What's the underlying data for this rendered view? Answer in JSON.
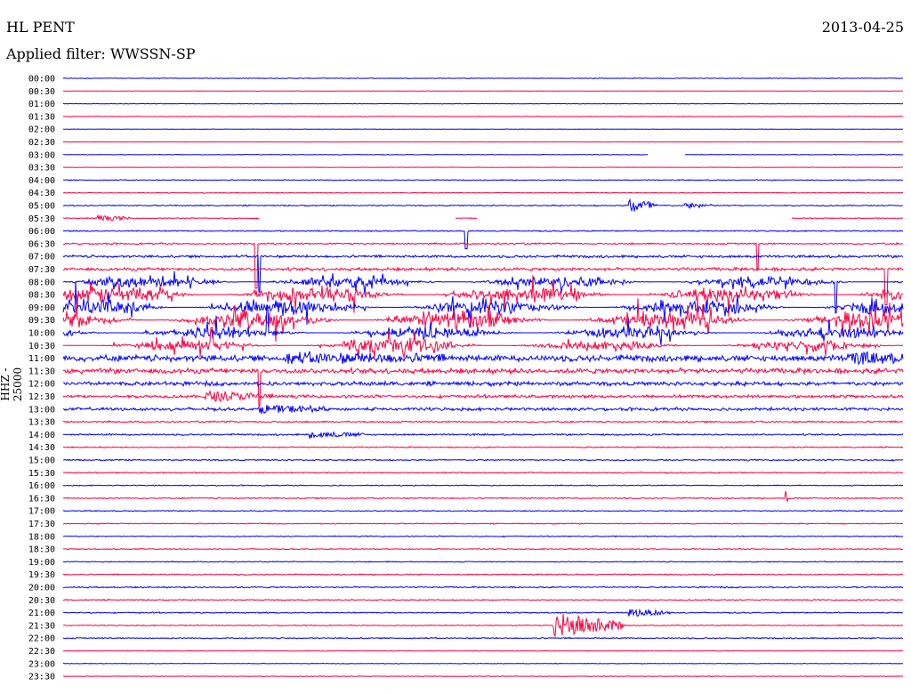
{
  "header": {
    "station": "HL PENT",
    "date": "2013-04-25",
    "filter": "Applied filter: WWSSN-SP"
  },
  "chart_data": {
    "type": "line",
    "title": "HL PENT 2013-04-25",
    "subtitle": "Applied filter: WWSSN-SP",
    "ylabel": "HHZ - 25000",
    "xlabel": "",
    "minutes_per_line": 30,
    "colors": [
      "#0000ff",
      "#ff0040"
    ],
    "row_labels": [
      "00:00",
      "00:30",
      "01:00",
      "01:30",
      "02:00",
      "02:30",
      "03:00",
      "03:30",
      "04:00",
      "04:30",
      "05:00",
      "05:30",
      "06:00",
      "06:30",
      "07:00",
      "07:30",
      "08:00",
      "08:30",
      "09:00",
      "09:30",
      "10:00",
      "10:30",
      "11:00",
      "11:30",
      "12:00",
      "12:30",
      "13:00",
      "13:30",
      "14:00",
      "14:30",
      "15:00",
      "15:30",
      "16:00",
      "16:30",
      "17:00",
      "17:30",
      "18:00",
      "18:30",
      "19:00",
      "19:30",
      "20:00",
      "20:30",
      "21:00",
      "21:30",
      "22:00",
      "22:30",
      "23:00",
      "23:30"
    ],
    "noise_level": [
      0.3,
      0.2,
      0.3,
      0.3,
      0.2,
      0.2,
      0.3,
      0.2,
      0.5,
      0.4,
      0.6,
      0.5,
      0.6,
      0.8,
      1.2,
      1.5,
      6,
      8,
      9,
      9,
      6,
      5,
      3,
      2.5,
      2.0,
      1.5,
      1.5,
      0.8,
      0.8,
      0.6,
      0.7,
      0.6,
      0.5,
      0.6,
      0.5,
      0.5,
      0.5,
      0.5,
      0.5,
      0.6,
      0.7,
      0.6,
      0.6,
      0.5,
      0.6,
      0.4,
      0.3,
      0.3
    ],
    "events": [
      {
        "row": 10,
        "minute": 20.2,
        "duration": 1.0,
        "amplitude": 9
      },
      {
        "row": 10,
        "minute": 22.2,
        "duration": 1.0,
        "amplitude": 3
      },
      {
        "row": 11,
        "minute": 1.2,
        "duration": 1.2,
        "amplitude": 3
      },
      {
        "row": 21,
        "minute": 10,
        "duration": 4,
        "amplitude": 4
      },
      {
        "row": 22,
        "minute": 8,
        "duration": 6,
        "amplitude": 4
      },
      {
        "row": 22,
        "minute": 28,
        "duration": 2,
        "amplitude": 5
      },
      {
        "row": 25,
        "minute": 5,
        "duration": 2.5,
        "amplitude": 5
      },
      {
        "row": 26,
        "minute": 7,
        "duration": 2.5,
        "amplitude": 4
      },
      {
        "row": 28,
        "minute": 8.8,
        "duration": 2,
        "amplitude": 3
      },
      {
        "row": 33,
        "minute": 25.8,
        "duration": 0.1,
        "amplitude": 9
      },
      {
        "row": 42,
        "minute": 20.2,
        "duration": 1.5,
        "amplitude": 4
      },
      {
        "row": 43,
        "minute": 17.5,
        "duration": 2.5,
        "amplitude": 14
      }
    ],
    "spikes": [
      {
        "row": 13,
        "minute": 6.9,
        "amplitude": -50
      },
      {
        "row": 14,
        "minute": 7.0,
        "amplitude": -40
      },
      {
        "row": 12,
        "minute": 14.4,
        "amplitude": -20
      },
      {
        "row": 13,
        "minute": 24.8,
        "amplitude": -30
      },
      {
        "row": 15,
        "minute": 29.4,
        "amplitude": -40
      },
      {
        "row": 16,
        "minute": 27.6,
        "amplitude": -35
      },
      {
        "row": 20,
        "minute": 7.3,
        "amplitude": 30
      },
      {
        "row": 21,
        "minute": 5.3,
        "amplitude": 20
      },
      {
        "row": 23,
        "minute": 7.0,
        "amplitude": -40
      },
      {
        "row": 6,
        "minute": 22.1,
        "amplitude": -8
      }
    ],
    "gaps": [
      {
        "row": 6,
        "from": 20.9,
        "to": 22.2
      },
      {
        "row": 11,
        "from": 7,
        "to": 14
      },
      {
        "row": 11,
        "from": 14.8,
        "to": 26
      }
    ]
  }
}
